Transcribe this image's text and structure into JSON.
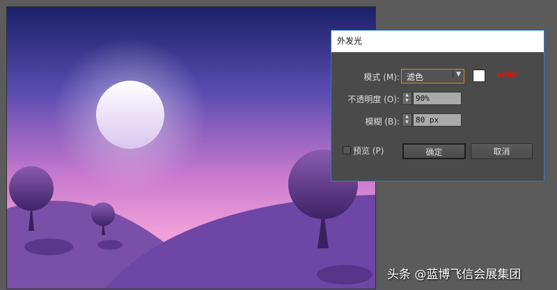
{
  "dialog": {
    "title": "外发光",
    "mode_label": "模式 (M):",
    "mode_value": "滤色",
    "color_swatch": "#ffffff",
    "color_note": "#ffffff",
    "opacity_label": "不透明度 (O):",
    "opacity_value": "90%",
    "blur_label": "模糊 (B):",
    "blur_value": "80 px",
    "preview_label": "预览 (P)",
    "preview_checked": false,
    "ok_label": "确定",
    "cancel_label": "取消"
  },
  "watermark": "头条 @蓝博飞信会展集团",
  "colors": {
    "accent": "#2a7fc9",
    "focus": "#d08a2a",
    "note": "#e01010"
  }
}
